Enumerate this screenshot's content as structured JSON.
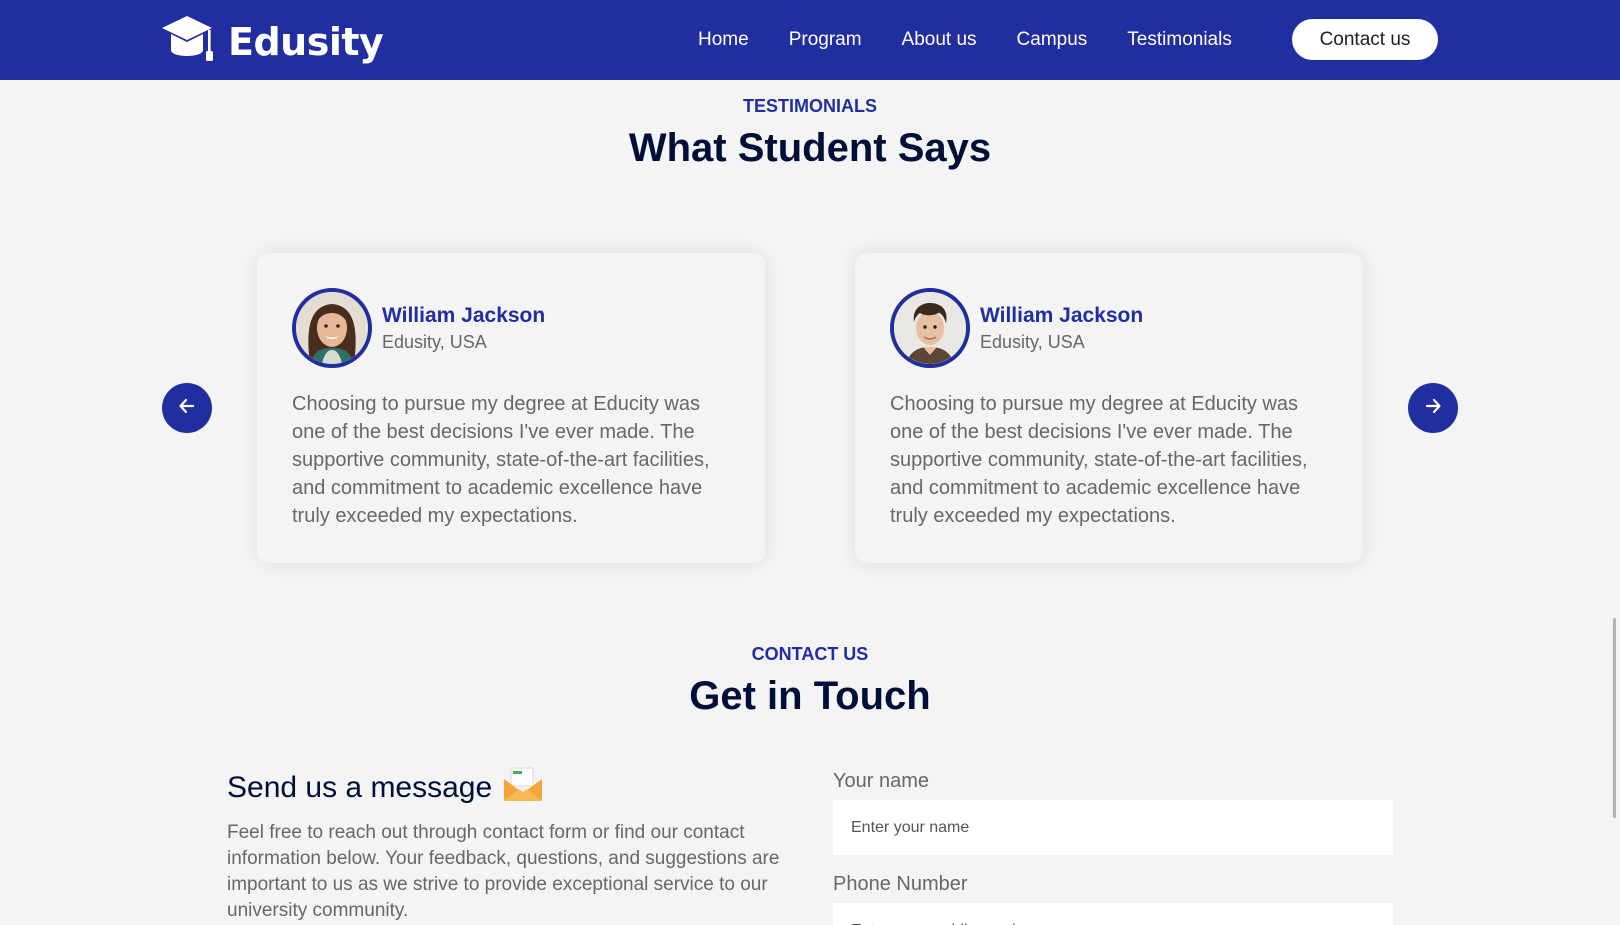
{
  "brand": {
    "name": "Edusity",
    "logo_icon": "graduation-cap-icon"
  },
  "nav": {
    "items": [
      {
        "label": "Home"
      },
      {
        "label": "Program"
      },
      {
        "label": "About us"
      },
      {
        "label": "Campus"
      },
      {
        "label": "Testimonials"
      }
    ],
    "cta_label": "Contact us"
  },
  "testimonials": {
    "subtitle": "TESTIMONIALS",
    "title": "What Student Says",
    "prev_icon": "arrow-left-icon",
    "next_icon": "arrow-right-icon",
    "cards": [
      {
        "name": "William Jackson",
        "location": "Edusity, USA",
        "avatar": "student-photo-woman",
        "quote": "Choosing to pursue my degree at Educity was one of the best decisions I've ever made. The supportive community, state-of-the-art facilities, and commitment to academic excellence have truly exceeded my expectations."
      },
      {
        "name": "William Jackson",
        "location": "Edusity, USA",
        "avatar": "student-photo-man",
        "quote": "Choosing to pursue my degree at Educity was one of the best decisions I've ever made. The supportive community, state-of-the-art facilities, and commitment to academic excellence have truly exceeded my expectations."
      }
    ]
  },
  "contact": {
    "subtitle": "CONTACT US",
    "title": "Get in Touch",
    "message_heading": "Send us a message",
    "message_icon": "envelope-icon",
    "message_text": "Feel free to reach out through contact form or find our contact information below. Your feedback, questions, and suggestions are important to us as we strive to provide exceptional service to our university community.",
    "fields": [
      {
        "label": "Your name",
        "placeholder": "Enter your name",
        "value": ""
      },
      {
        "label": "Phone Number",
        "placeholder": "Enter your mobile number",
        "value": ""
      }
    ]
  },
  "colors": {
    "primary": "#212ea0",
    "heading": "#000f38",
    "body_text": "#676767",
    "background": "#f4f4f4"
  }
}
